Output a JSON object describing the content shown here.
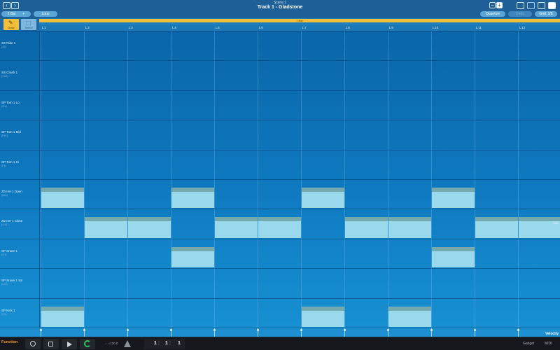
{
  "header": {
    "scene": "Scene 1",
    "title": "Track 1 - Gladstone",
    "back_icon": "chevron-left-icon",
    "forward_icon": "chevron-right-icon",
    "length_label": "1 Bar",
    "loop_label": "Loop",
    "quantize_label": "Quantize",
    "disabled_label": "Undo",
    "grid_label": "Grid: 1/8",
    "minus_label": "−",
    "plus_label": "+"
  },
  "region": {
    "label": "1 Bar"
  },
  "tools": [
    {
      "label": "Draw",
      "icon": "pencil-icon",
      "glyph": "✎",
      "active": true
    },
    {
      "label": "Select",
      "icon": "cursor-icon",
      "glyph": "⬚",
      "active": false
    }
  ],
  "ruler": [
    "1.1",
    "1.2",
    "1.3",
    "1.4",
    "1.5",
    "1.6",
    "1.7",
    "1.8",
    "1.9",
    "1.10",
    "1.11",
    "1.12"
  ],
  "rows": [
    {
      "name": "SS Ride 1",
      "note": "(A2)"
    },
    {
      "name": "SS Crash 1",
      "note": "(C#2)"
    },
    {
      "name": "SP Tom 1 Lo",
      "note": "(G1)"
    },
    {
      "name": "SP Tom 1 Mid",
      "note": "(F#1)"
    },
    {
      "name": "SP Tom 1 Hi",
      "note": "(F1)"
    },
    {
      "name": "ZD HH 1 Open",
      "note": "(A#1)"
    },
    {
      "name": "ZD HH 1 Close",
      "note": "(G#1)"
    },
    {
      "name": "SP Snare 1",
      "note": "(D1)"
    },
    {
      "name": "SP Snare 1 SS",
      "note": "(C#1)"
    },
    {
      "name": "SP Kick 1",
      "note": "(C1)"
    }
  ],
  "pattern": [
    [],
    [],
    [],
    [],
    [],
    [
      0,
      3,
      6,
      9
    ],
    [
      1,
      2,
      4,
      5,
      7,
      8,
      10,
      11
    ],
    [
      3,
      9
    ],
    [],
    [
      0,
      6,
      8
    ]
  ],
  "side_marker": "G#1",
  "velocity_label": "Velocity",
  "colors": {
    "region": "#f3bf3a",
    "note": "#9ad8ec",
    "note_cap": "#74a9ae",
    "function": "#f39a2a",
    "cycle": "#2bc35a"
  },
  "control": {
    "function_label": "Function",
    "tempo": "♩=120.0",
    "position": {
      "bar": "1",
      "beat": "1",
      "division": "1"
    },
    "gadget_label": "Gadget",
    "midi_label": "MIDI",
    "icons": [
      "record-icon",
      "stop-icon",
      "play-icon",
      "cycle-icon",
      "metronome-icon"
    ]
  }
}
